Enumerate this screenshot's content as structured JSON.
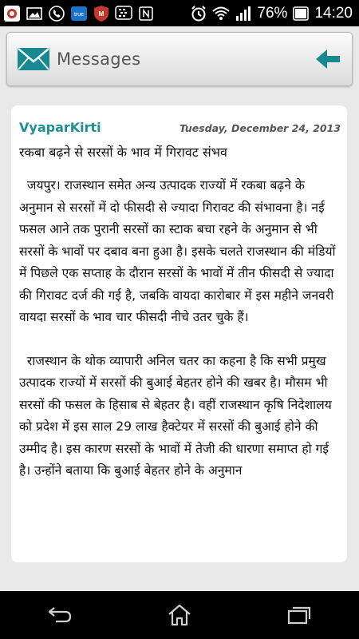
{
  "status_bar": {
    "battery_percent": "76%",
    "time": "14:20",
    "icons": [
      "app-icon",
      "image-icon",
      "phone-icon",
      "truecaller-icon",
      "mcafee-icon",
      "bbm-icon",
      "nfc-icon",
      "alarm-icon",
      "wifi-icon",
      "signal-icon",
      "battery-icon"
    ],
    "truecaller_label": "true"
  },
  "header": {
    "title": "Messages",
    "icon": "mail-icon",
    "back_icon": "back-arrow-icon"
  },
  "message": {
    "sender": "VyaparKirti",
    "date": "Tuesday, December 24, 2013",
    "subject": "रकबा बढ़ने से सरसों के भाव में गिरावट संभव",
    "paragraphs": [
      "  जयपुर। राजस्थान समेत अन्य उत्पादक राज्यों में रकबा बढ़ने के अनुमान से सरसों में दो फीसदी से ज्यादा गिरावट की संभावना है। नई फसल आने तक पुरानी सरसों का स्टाक बचा रहने के अनुमान से भी सरसों के भावों पर दबाव बना हुआ है। इसके चलते राजस्थान की मंडियों में पिछले एक सप्ताह के दौरान सरसों के भावों में तीन फीसदी से ज्यादा की गिरावट दर्ज की गई है, जबकि वायदा कारोबार में इस महीने जनवरी वायदा सरसों के भाव चार फीसदी नीचे उतर चुके हैं।",
      "  राजस्थान के थोक व्यापारी अनिल चतर का कहना है कि सभी प्रमुख उत्पादक राज्यों में सरसों की बुआई बेहतर होने की खबर है। मौसम भी सरसों की फसल के हिसाब से बेहतर है। वहीं राजस्थान कृषि निदेशालय को प्रदेश में इस साल 29 लाख हैक्टेयर में सरसों की बुआई होने की उम्मीद है। इस कारण सरसों के भावों में तेजी की धारणा समाप्त हो गई है। उन्होंने बताया कि बुआई बेहतर होने के अनुमान"
    ]
  },
  "nav": {
    "back": "nav-back-icon",
    "home": "nav-home-icon",
    "recents": "nav-recents-icon"
  },
  "colors": {
    "accent": "#1e8f93",
    "header_icon": "#17898f",
    "background": "#e9e9e9"
  }
}
